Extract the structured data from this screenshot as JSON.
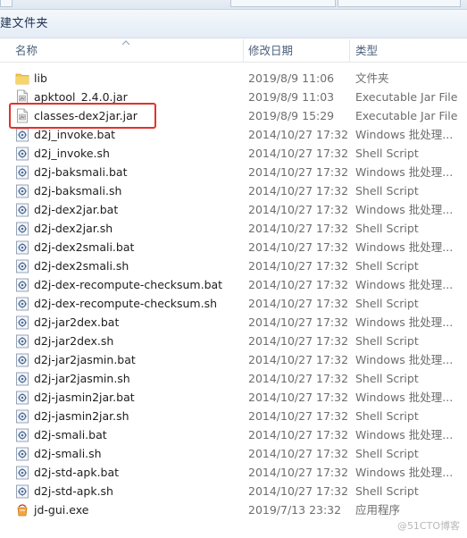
{
  "toolbar": {
    "new_folder_label": "建文件夹"
  },
  "header": {
    "col_name": "名称",
    "col_date": "修改日期",
    "col_type": "类型"
  },
  "files": [
    {
      "name": "lib",
      "date": "2019/8/9 11:06",
      "type": "文件夹",
      "icon": "folder-icon"
    },
    {
      "name": "apktool_2.4.0.jar",
      "date": "2019/8/9 11:03",
      "type": "Executable Jar File",
      "icon": "jar-file-icon"
    },
    {
      "name": "classes-dex2jar.jar",
      "date": "2019/8/9 15:29",
      "type": "Executable Jar File",
      "icon": "jar-file-icon"
    },
    {
      "name": "d2j_invoke.bat",
      "date": "2014/10/27 17:32",
      "type": "Windows 批处理...",
      "icon": "batch-file-icon"
    },
    {
      "name": "d2j_invoke.sh",
      "date": "2014/10/27 17:32",
      "type": "Shell Script",
      "icon": "shell-script-icon"
    },
    {
      "name": "d2j-baksmali.bat",
      "date": "2014/10/27 17:32",
      "type": "Windows 批处理...",
      "icon": "batch-file-icon"
    },
    {
      "name": "d2j-baksmali.sh",
      "date": "2014/10/27 17:32",
      "type": "Shell Script",
      "icon": "shell-script-icon"
    },
    {
      "name": "d2j-dex2jar.bat",
      "date": "2014/10/27 17:32",
      "type": "Windows 批处理...",
      "icon": "batch-file-icon"
    },
    {
      "name": "d2j-dex2jar.sh",
      "date": "2014/10/27 17:32",
      "type": "Shell Script",
      "icon": "shell-script-icon"
    },
    {
      "name": "d2j-dex2smali.bat",
      "date": "2014/10/27 17:32",
      "type": "Windows 批处理...",
      "icon": "batch-file-icon"
    },
    {
      "name": "d2j-dex2smali.sh",
      "date": "2014/10/27 17:32",
      "type": "Shell Script",
      "icon": "shell-script-icon"
    },
    {
      "name": "d2j-dex-recompute-checksum.bat",
      "date": "2014/10/27 17:32",
      "type": "Windows 批处理...",
      "icon": "batch-file-icon"
    },
    {
      "name": "d2j-dex-recompute-checksum.sh",
      "date": "2014/10/27 17:32",
      "type": "Shell Script",
      "icon": "shell-script-icon"
    },
    {
      "name": "d2j-jar2dex.bat",
      "date": "2014/10/27 17:32",
      "type": "Windows 批处理...",
      "icon": "batch-file-icon"
    },
    {
      "name": "d2j-jar2dex.sh",
      "date": "2014/10/27 17:32",
      "type": "Shell Script",
      "icon": "shell-script-icon"
    },
    {
      "name": "d2j-jar2jasmin.bat",
      "date": "2014/10/27 17:32",
      "type": "Windows 批处理...",
      "icon": "batch-file-icon"
    },
    {
      "name": "d2j-jar2jasmin.sh",
      "date": "2014/10/27 17:32",
      "type": "Shell Script",
      "icon": "shell-script-icon"
    },
    {
      "name": "d2j-jasmin2jar.bat",
      "date": "2014/10/27 17:32",
      "type": "Windows 批处理...",
      "icon": "batch-file-icon"
    },
    {
      "name": "d2j-jasmin2jar.sh",
      "date": "2014/10/27 17:32",
      "type": "Shell Script",
      "icon": "shell-script-icon"
    },
    {
      "name": "d2j-smali.bat",
      "date": "2014/10/27 17:32",
      "type": "Windows 批处理...",
      "icon": "batch-file-icon"
    },
    {
      "name": "d2j-smali.sh",
      "date": "2014/10/27 17:32",
      "type": "Shell Script",
      "icon": "shell-script-icon"
    },
    {
      "name": "d2j-std-apk.bat",
      "date": "2014/10/27 17:32",
      "type": "Windows 批处理...",
      "icon": "batch-file-icon"
    },
    {
      "name": "d2j-std-apk.sh",
      "date": "2014/10/27 17:32",
      "type": "Shell Script",
      "icon": "shell-script-icon"
    },
    {
      "name": "jd-gui.exe",
      "date": "2019/7/13 23:32",
      "type": "应用程序",
      "icon": "application-icon"
    }
  ],
  "watermark": "@51CTO博客",
  "colors": {
    "highlight": "#e3312a",
    "folder": "#f2c44f"
  }
}
